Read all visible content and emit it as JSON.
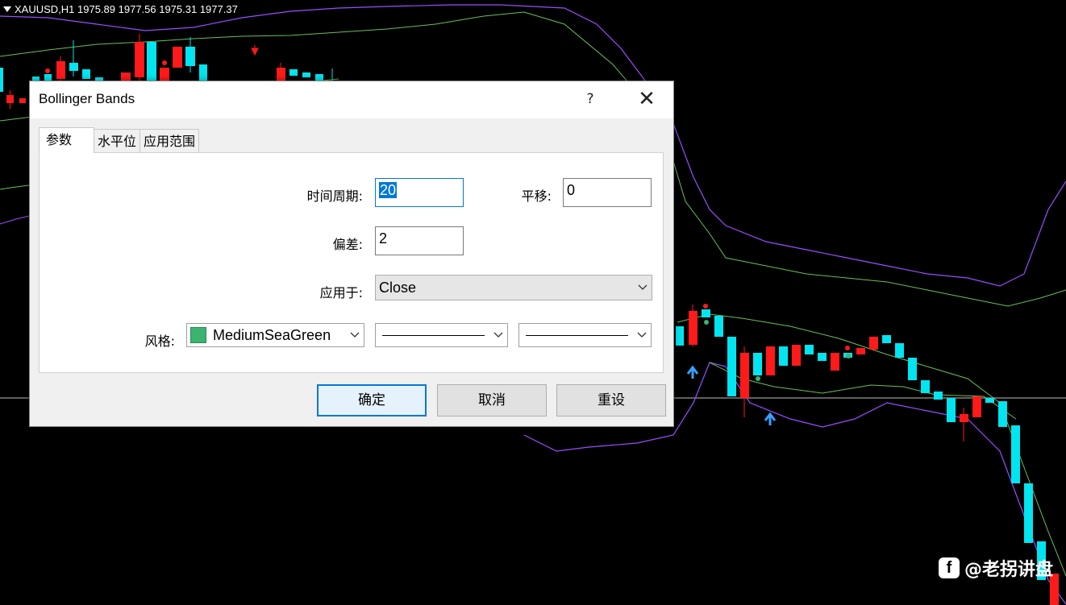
{
  "chart": {
    "header": "XAUUSD,H1  1975.89 1977.56 1975.31 1977.37",
    "watermark": "@老拐讲盘",
    "watermark_logo": "f",
    "colors": {
      "bull": "#00e5f0",
      "bear": "#ff1a1a",
      "upper_band": "#9b4dff",
      "mid_band": "#6abf5a",
      "crosshair": "#c8c8c8",
      "arrow_up": "#3aa0ff",
      "arrow_down": "#ff1a1a"
    }
  },
  "dialog": {
    "title": "Bollinger Bands",
    "help_icon": "?",
    "close_icon": "✕",
    "tabs": [
      {
        "label": "参数",
        "active": true
      },
      {
        "label": "水平位",
        "active": false
      },
      {
        "label": "应用范围",
        "active": false
      }
    ],
    "fields": {
      "period_label": "时间周期:",
      "period_value": "20",
      "shift_label": "平移:",
      "shift_value": "0",
      "deviation_label": "偏差:",
      "deviation_value": "2",
      "apply_label": "应用于:",
      "apply_value": "Close",
      "style_label": "风格:",
      "color_value": "MediumSeaGreen",
      "color_hex": "#3cb371"
    },
    "buttons": {
      "ok": "确定",
      "cancel": "取消",
      "reset": "重设"
    }
  }
}
